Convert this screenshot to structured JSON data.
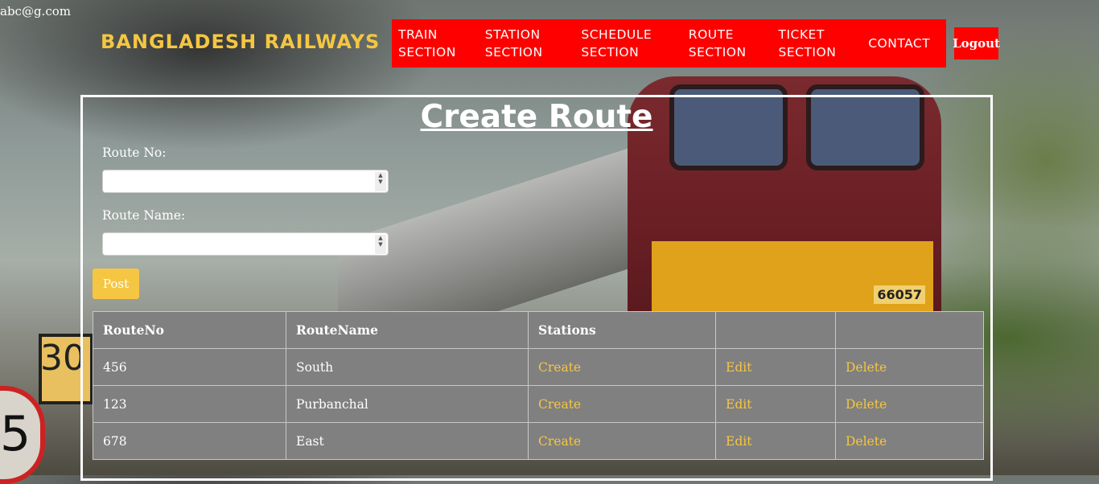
{
  "user": {
    "email": "abc@g.com"
  },
  "brand": {
    "title": "BANGLADESH RAILWAYS"
  },
  "nav": {
    "items": [
      {
        "line1": "TRAIN",
        "line2": "SECTION"
      },
      {
        "line1": "STATION",
        "line2": "SECTION"
      },
      {
        "line1": "SCHEDULE",
        "line2": "SECTION"
      },
      {
        "line1": "ROUTE",
        "line2": "SECTION"
      },
      {
        "line1": "TICKET",
        "line2": "SECTION"
      },
      {
        "line1": "CONTACT",
        "line2": ""
      }
    ],
    "logout_label": "Logout"
  },
  "form": {
    "title": "Create Route",
    "route_no_label": "Route No:",
    "route_no_value": "",
    "route_name_label": "Route Name:",
    "route_name_value": "",
    "post_label": "Post"
  },
  "table": {
    "headers": [
      "RouteNo",
      "RouteName",
      "Stations",
      "",
      ""
    ],
    "rows": [
      {
        "route_no": "456",
        "route_name": "South",
        "stations_link": "Create",
        "edit_link": "Edit",
        "delete_link": "Delete"
      },
      {
        "route_no": "123",
        "route_name": "Purbanchal",
        "stations_link": "Create",
        "edit_link": "Edit",
        "delete_link": "Delete"
      },
      {
        "route_no": "678",
        "route_name": "East",
        "stations_link": "Create",
        "edit_link": "Edit",
        "delete_link": "Delete"
      }
    ]
  },
  "background": {
    "sign_digit": "5",
    "sign_limit": "30",
    "loco_number": "66057"
  },
  "colors": {
    "nav_bg": "#ff0000",
    "accent_yellow": "#f5c642",
    "table_bg": "#808080"
  }
}
